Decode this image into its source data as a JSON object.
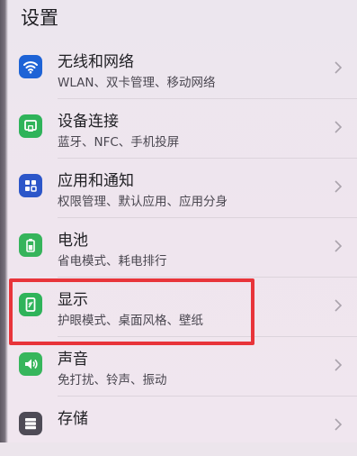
{
  "header": {
    "title": "设置"
  },
  "items": [
    {
      "id": "wireless",
      "title": "无线和网络",
      "subtitle": "WLAN、双卡管理、移动网络",
      "icon": "wifi-icon",
      "color": "#1e63d6"
    },
    {
      "id": "device-connect",
      "title": "设备连接",
      "subtitle": "蓝牙、NFC、手机投屏",
      "icon": "device-connect-icon",
      "color": "#2fb35a"
    },
    {
      "id": "apps",
      "title": "应用和通知",
      "subtitle": "权限管理、默认应用、应用分身",
      "icon": "apps-grid-icon",
      "color": "#2c56c9"
    },
    {
      "id": "battery",
      "title": "电池",
      "subtitle": "省电模式、耗电排行",
      "icon": "battery-icon",
      "color": "#36b45b"
    },
    {
      "id": "display",
      "title": "显示",
      "subtitle": "护眼模式、桌面风格、壁纸",
      "icon": "display-icon",
      "color": "#2fb35a"
    },
    {
      "id": "sound",
      "title": "声音",
      "subtitle": "免打扰、铃声、振动",
      "icon": "speaker-icon",
      "color": "#37b65c"
    },
    {
      "id": "storage",
      "title": "存储",
      "subtitle": "",
      "icon": "storage-icon",
      "color": "#4e4b56"
    }
  ],
  "highlight_color": "#e8343a"
}
